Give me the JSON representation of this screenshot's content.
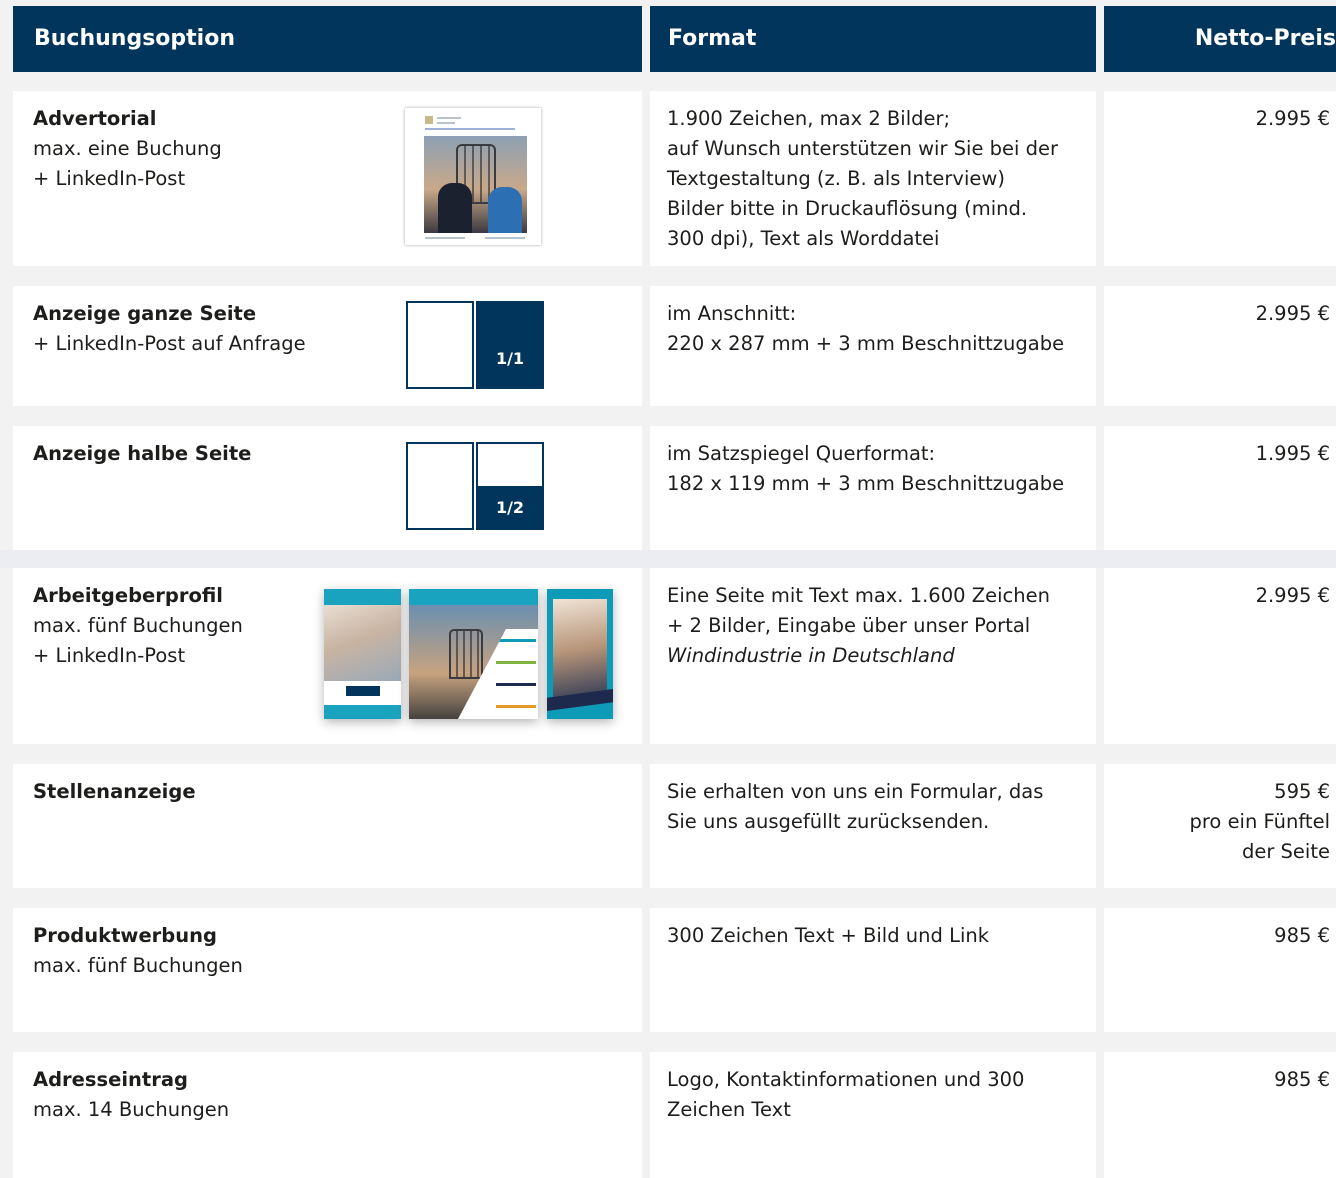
{
  "header": {
    "col1": "Buchungsoption",
    "col2": "Format",
    "col3": "Netto-Preis"
  },
  "rows": [
    {
      "title": "Advertorial",
      "lines": [
        "max. eine Buchung",
        "+ LinkedIn-Post"
      ],
      "format": [
        "1.900 Zeichen, max 2 Bilder;",
        "auf Wunsch unterstützen wir Sie bei der",
        "Textgestaltung (z. B. als Interview)",
        "Bilder bitte in Druckauflösung (mind.",
        "300 dpi), Text als Worddatei"
      ],
      "price": [
        "2.995 €"
      ]
    },
    {
      "title": "Anzeige ganze Seite",
      "lines": [
        "+ LinkedIn-Post auf Anfrage"
      ],
      "format": [
        "im Anschnitt:",
        "220 x 287 mm + 3 mm Beschnittzugabe"
      ],
      "price": [
        "2.995 €"
      ],
      "icon_label": "1/1"
    },
    {
      "title": "Anzeige halbe Seite",
      "lines": [],
      "format": [
        "im Satzspiegel Querformat:",
        "182 x 119 mm + 3 mm Beschnittzugabe"
      ],
      "price": [
        "1.995 €"
      ],
      "icon_label": "1/2"
    },
    {
      "title": "Arbeitgeberprofil",
      "lines": [
        "max. fünf Buchungen",
        "+ LinkedIn-Post"
      ],
      "format": [
        "Eine Seite mit Text max. 1.600 Zeichen",
        "+ 2 Bilder, Eingabe über unser Portal"
      ],
      "format_italic": "Windindustrie in Deutschland",
      "price": [
        "2.995 €"
      ]
    },
    {
      "title": "Stellenanzeige",
      "lines": [],
      "format": [
        "Sie erhalten von uns ein Formular, das",
        "Sie uns ausgefüllt zurücksenden."
      ],
      "price": [
        "595 €",
        "pro ein Fünftel",
        "der Seite"
      ]
    },
    {
      "title": "Produktwerbung",
      "lines": [
        "max. fünf Buchungen"
      ],
      "format": [
        "300 Zeichen Text + Bild und Link"
      ],
      "price": [
        "985 €"
      ]
    },
    {
      "title": "Adresseintrag",
      "lines": [
        "max. 14 Buchungen"
      ],
      "format": [
        "Logo, Kontaktinformationen und 300",
        "Zeichen Text"
      ],
      "price": [
        "985 €"
      ]
    }
  ],
  "colors": {
    "header_bg": "#02355c",
    "page_bg": "#f2f2f2",
    "cell_bg": "#ffffff",
    "accent_teal": "#0e9bb8"
  }
}
